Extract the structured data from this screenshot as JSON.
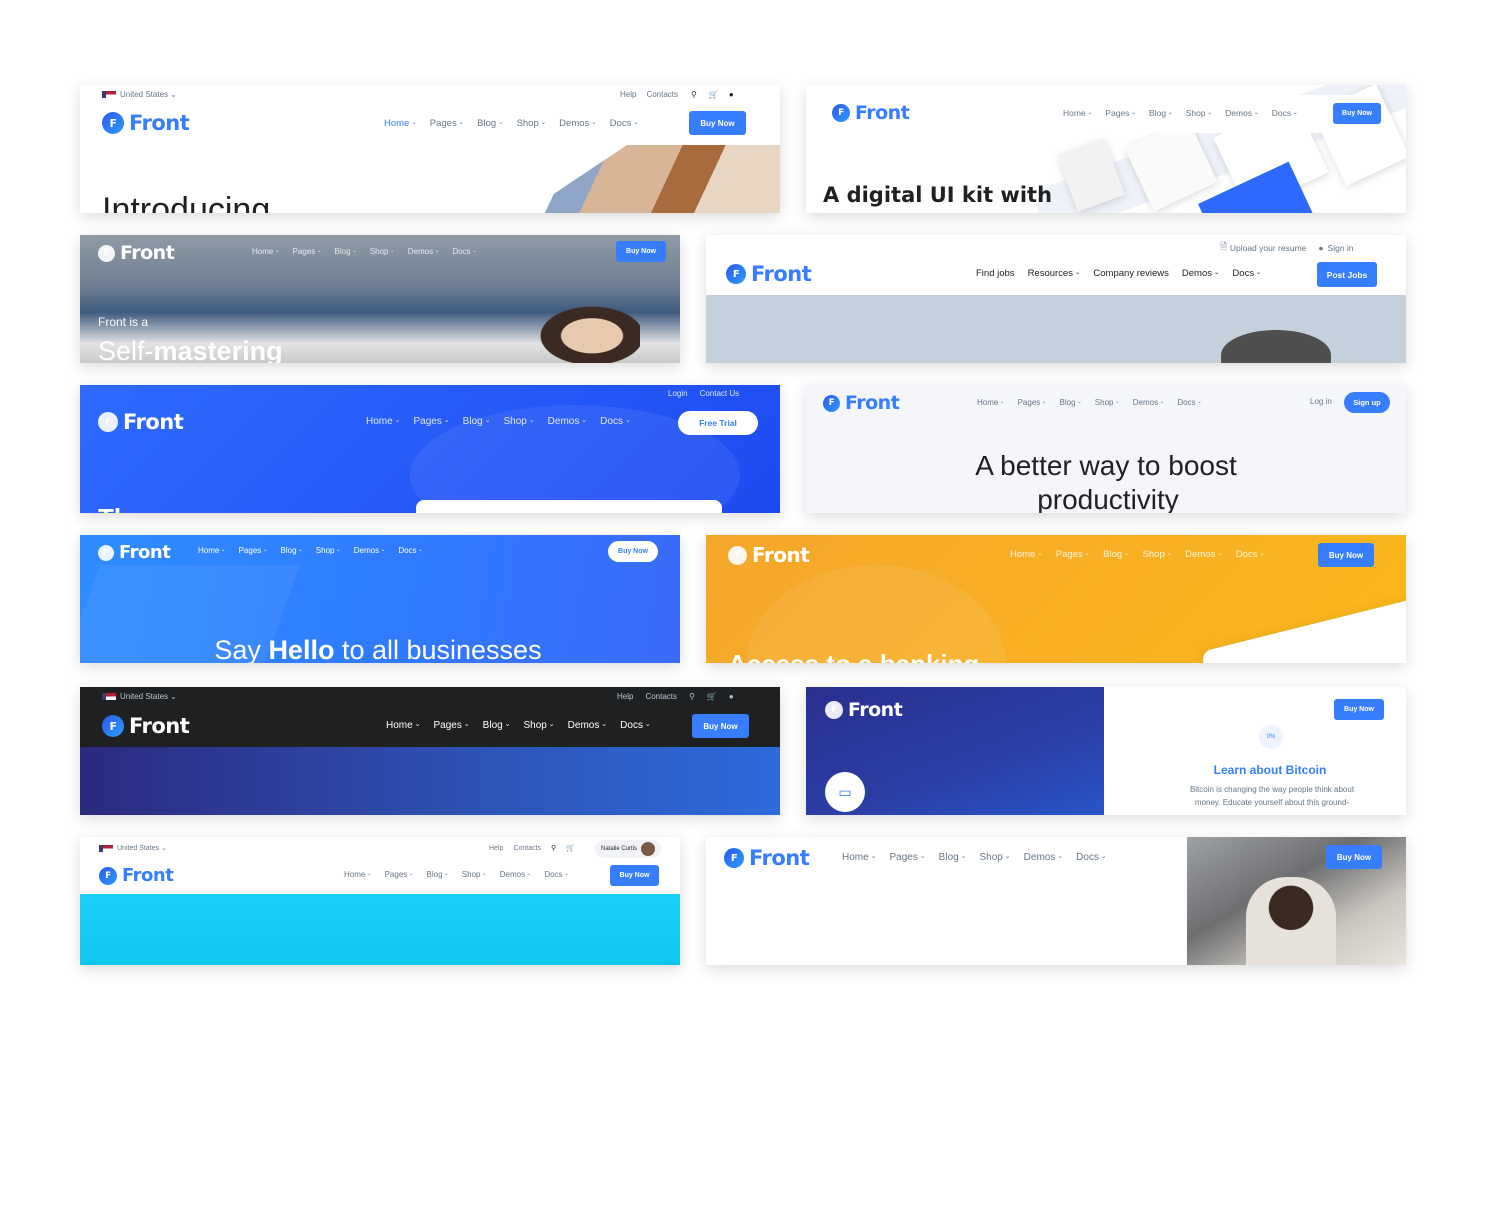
{
  "brand": "Front",
  "logo_letter": "F",
  "colors": {
    "primary": "#377dff",
    "blue_bg": "#2d69ff",
    "orange": "#f7a51d",
    "dark": "#1e2022",
    "navy": "#2a2f8f",
    "cyan": "#1ad1f6"
  },
  "c1": {
    "country": "United States",
    "help": "Help",
    "contacts": "Contacts",
    "nav": [
      "Home",
      "Pages",
      "Blog",
      "Shop",
      "Demos",
      "Docs"
    ],
    "cta": "Buy Now",
    "hero": "Introducing"
  },
  "c2": {
    "nav": [
      "Home",
      "Pages",
      "Blog",
      "Shop",
      "Demos",
      "Docs"
    ],
    "cta": "Buy Now",
    "hero": "A digital UI kit with"
  },
  "c3": {
    "nav": [
      "Home",
      "Pages",
      "Blog",
      "Shop",
      "Demos",
      "Docs"
    ],
    "cta": "Buy Now",
    "small": "Front is a",
    "big_a": "Self-",
    "big_b": "mastering"
  },
  "c4": {
    "upload": "Upload your resume",
    "signin": "Sign in",
    "nav": [
      "Find jobs",
      "Resources",
      "Company reviews",
      "Demos",
      "Docs"
    ],
    "cta": "Post Jobs"
  },
  "c5": {
    "login": "Login",
    "contact": "Contact Us",
    "nav": [
      "Home",
      "Pages",
      "Blog",
      "Shop",
      "Demos",
      "Docs"
    ],
    "cta": "Free Trial",
    "hero": "Th"
  },
  "c6": {
    "nav": [
      "Home",
      "Pages",
      "Blog",
      "Shop",
      "Demos",
      "Docs"
    ],
    "login": "Log in",
    "cta": "Sign up",
    "line1": "A better way to boost",
    "line2": "productivity"
  },
  "c7": {
    "nav": [
      "Home",
      "Pages",
      "Blog",
      "Shop",
      "Demos",
      "Docs"
    ],
    "cta": "Buy Now",
    "hero_a": "Say ",
    "hero_b": "Hello",
    "hero_c": " to all businesses"
  },
  "c8": {
    "nav": [
      "Home",
      "Pages",
      "Blog",
      "Shop",
      "Demos",
      "Docs"
    ],
    "cta": "Buy Now",
    "hero": "Access to a banking"
  },
  "c9": {
    "country": "United States",
    "help": "Help",
    "contacts": "Contacts",
    "nav": [
      "Home",
      "Pages",
      "Blog",
      "Shop",
      "Demos",
      "Docs"
    ],
    "cta": "Buy Now"
  },
  "c10": {
    "cta": "Buy Now",
    "badge": "0%",
    "title": "Learn about Bitcoin",
    "text1": "Bitcoin is changing the way people think about",
    "text2": "money. Educate yourself about this ground-"
  },
  "c11": {
    "country": "United States",
    "help": "Help",
    "contacts": "Contacts",
    "user": "Natalie Curtis",
    "nav": [
      "Home",
      "Pages",
      "Blog",
      "Shop",
      "Demos",
      "Docs"
    ],
    "cta": "Buy Now"
  },
  "c12": {
    "nav": [
      "Home",
      "Pages",
      "Blog",
      "Shop",
      "Demos",
      "Docs"
    ],
    "cta": "Buy Now"
  }
}
